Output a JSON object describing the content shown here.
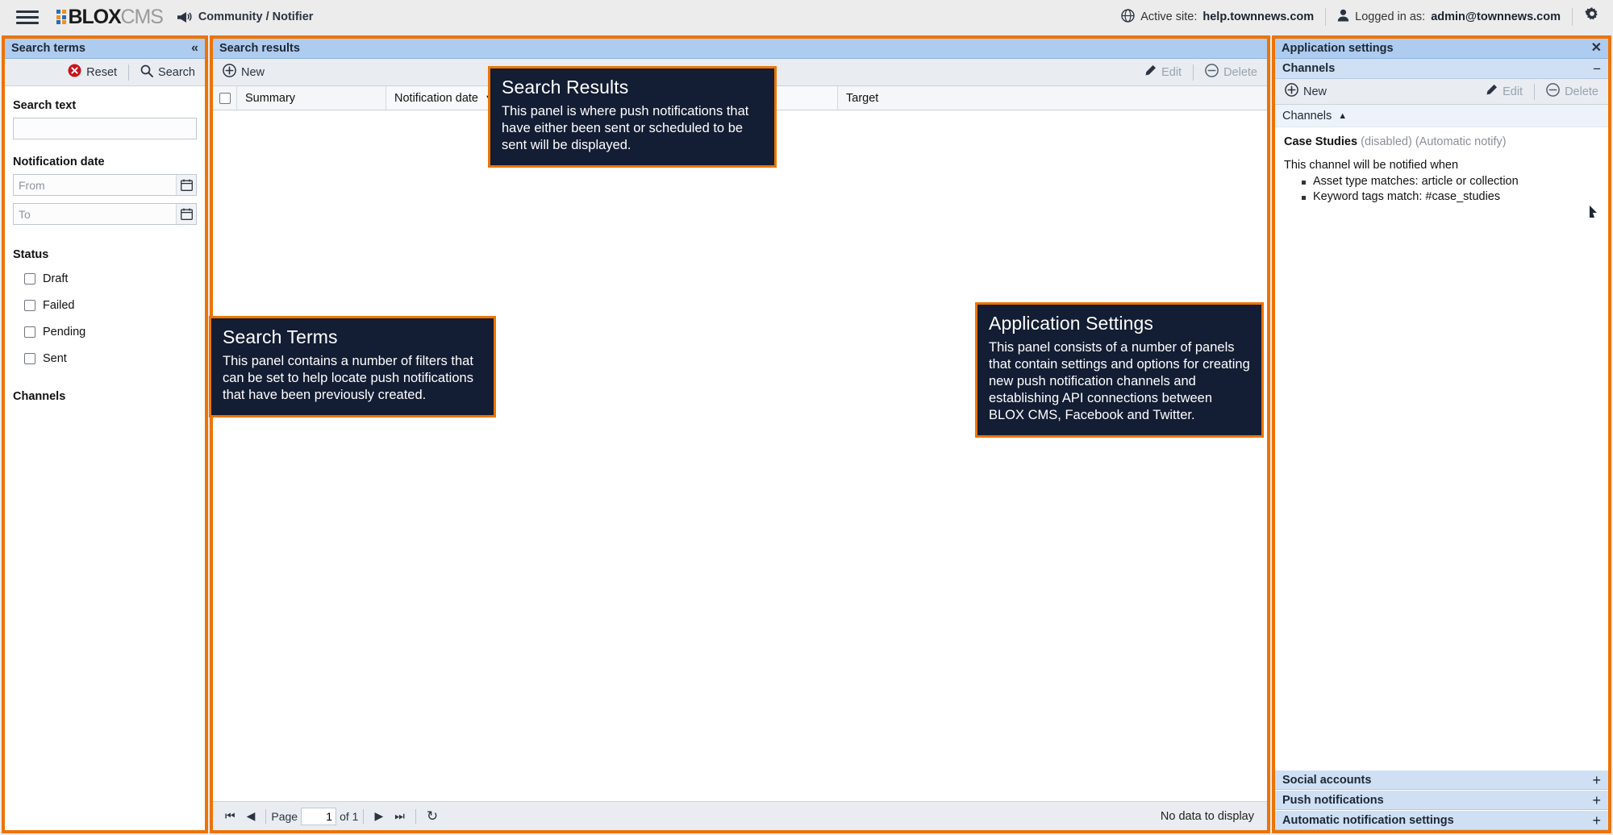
{
  "header": {
    "menu_icon": "hamburger-icon",
    "logo_text": "BLOX",
    "logo_suffix": "CMS",
    "app_icon": "megaphone-icon",
    "app_name": "Community / Notifier",
    "active_site_label": "Active site:",
    "active_site_value": "help.townnews.com",
    "logged_in_label": "Logged in as:",
    "logged_in_value": "admin@townnews.com",
    "globe_icon": "globe-icon",
    "user_icon": "user-icon",
    "settings_icon": "gear-icon"
  },
  "search_terms": {
    "title": "Search terms",
    "collapse_icon": "«",
    "reset_label": "Reset",
    "search_label": "Search",
    "search_text_label": "Search text",
    "search_text_value": "",
    "notification_date_label": "Notification date",
    "date_from_placeholder": "From",
    "date_from_value": "",
    "date_to_placeholder": "To",
    "date_to_value": "",
    "status_label": "Status",
    "status_options": [
      {
        "label": "Draft",
        "checked": false
      },
      {
        "label": "Failed",
        "checked": false
      },
      {
        "label": "Pending",
        "checked": false
      },
      {
        "label": "Sent",
        "checked": false
      }
    ],
    "channels_label": "Channels"
  },
  "search_results": {
    "title": "Search results",
    "new_label": "New",
    "edit_label": "Edit",
    "delete_label": "Delete",
    "columns": [
      "Summary",
      "Notification date",
      "Target"
    ],
    "sort_column": "Notification date",
    "sort_direction": "desc",
    "rows": [],
    "pager": {
      "first_icon": "first-page-icon",
      "prev_icon": "prev-page-icon",
      "page_label": "Page",
      "page_value": "1",
      "of_label": "of 1",
      "next_icon": "next-page-icon",
      "last_icon": "last-page-icon",
      "refresh_icon": "refresh-icon",
      "status_text": "No data to display"
    }
  },
  "application_settings": {
    "title": "Application settings",
    "close_icon": "close-icon",
    "channels_section": {
      "title": "Channels",
      "collapse_icon": "−",
      "new_label": "New",
      "edit_label": "Edit",
      "delete_label": "Delete",
      "list_header": "Channels",
      "list_header_caret": "▲",
      "channel_name": "Case Studies",
      "channel_state": "(disabled)",
      "channel_mode": "(Automatic notify)",
      "notify_intro": "This channel will be notified when",
      "notify_rules": [
        "Asset type matches: article or collection",
        "Keyword tags match: #case_studies"
      ]
    },
    "accordions": [
      {
        "label": "Social accounts",
        "expand_icon": "+"
      },
      {
        "label": "Push notifications",
        "expand_icon": "+"
      },
      {
        "label": "Automatic notification settings",
        "expand_icon": "+"
      }
    ]
  },
  "callouts": [
    {
      "id": "search-results",
      "title": "Search Results",
      "body": "This panel is where push notifications that have either been sent or scheduled to be sent will be displayed."
    },
    {
      "id": "search-terms",
      "title": "Search Terms",
      "body": "This panel contains a number of filters that can be set to help locate push notifications that have been previously created."
    },
    {
      "id": "application-settings",
      "title": "Application Settings",
      "body": "This panel consists of a number of panels that contain settings and options for creating new push notification channels and establishing API connections between BLOX CMS, Facebook and Twitter."
    }
  ],
  "colors": {
    "accent_orange": "#ec7404",
    "panel_header_blue": "#aecbf0",
    "subpanel_blue": "#cfe0f5",
    "callout_navy": "#131d33",
    "logo_blue": "#2b6cb3",
    "logo_orange": "#f0901e"
  }
}
